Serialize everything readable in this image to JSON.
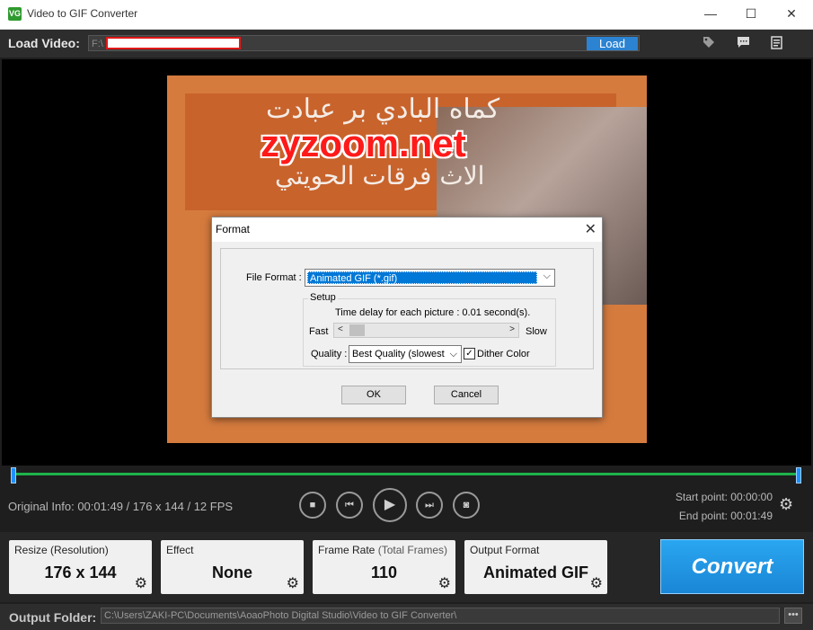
{
  "window": {
    "app_icon_text": "VG",
    "title": "Video to GIF Converter",
    "minimize": "—",
    "maximize": "☐",
    "close": "✕"
  },
  "load_bar": {
    "label": "Load Video:",
    "path_prefix": "F:\\",
    "load_button": "Load"
  },
  "top_icons": [
    "tag-icon",
    "comment-icon",
    "list-icon"
  ],
  "preview": {
    "watermark": "zyzoom.net",
    "arabic_line_1": "كماه البادي بر عبادت",
    "arabic_line_2": "الاث فرقات الحويتي"
  },
  "dialog": {
    "title": "Format",
    "close": "✕",
    "file_format_label": "File Format :",
    "file_format_value": "Animated GIF (*.gif)",
    "setup_title": "Setup",
    "delay_text": "Time delay for each picture  : 0.01 second(s).",
    "fast": "Fast",
    "slow": "Slow",
    "delay_slider_level": 0.01,
    "quality_label": "Quality :",
    "quality_value": "Best Quality (slowest",
    "dither_label": "Dither Color",
    "dither_checked": true,
    "ok": "OK",
    "cancel": "Cancel"
  },
  "player": {
    "original_info": "Original Info: 00:01:49 / 176 x 144 / 12 FPS",
    "start_point": "Start point: 00:00:00",
    "end_point": "End point: 00:01:49",
    "controls": [
      "stop-icon",
      "previous-icon",
      "play-icon",
      "next-icon",
      "snapshot-icon"
    ]
  },
  "cards": {
    "resize": {
      "label": "Resize (Resolution)",
      "value": "176 x 144"
    },
    "effect": {
      "label": "Effect",
      "value": "None"
    },
    "frame_rate": {
      "label": "Frame Rate",
      "sub": "(Total Frames)",
      "value": "110"
    },
    "output_format": {
      "label": "Output Format",
      "value": "Animated GIF"
    }
  },
  "convert_button": "Convert",
  "output": {
    "label": "Output Folder:",
    "path": "C:\\Users\\ZAKI-PC\\Documents\\AoaoPhoto Digital Studio\\Video to GIF Converter\\",
    "browse": "•••"
  },
  "colors": {
    "accent_blue": "#2b83d2",
    "timeline_green": "#1db34a",
    "watermark_red": "#ff1a1a"
  }
}
